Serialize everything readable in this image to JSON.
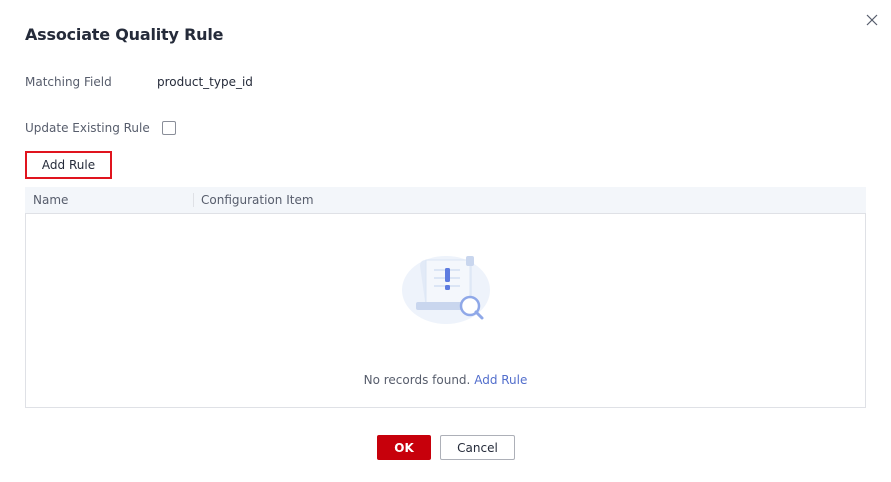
{
  "dialog": {
    "title": "Associate Quality Rule"
  },
  "form": {
    "matching_field_label": "Matching Field",
    "matching_field_value": "product_type_id",
    "update_existing_label": "Update Existing Rule",
    "update_existing_checked": false
  },
  "toolbar": {
    "add_rule_label": "Add Rule"
  },
  "table": {
    "columns": [
      "Name",
      "Configuration Item"
    ],
    "rows": [],
    "empty_text": "No records found.",
    "empty_link": "Add Rule"
  },
  "footer": {
    "ok_label": "OK",
    "cancel_label": "Cancel"
  },
  "colors": {
    "primary": "#c7000b",
    "highlight_border": "#e0141e",
    "link": "#526ecc",
    "header_bg": "#f3f6fa"
  },
  "icons": {
    "close": "close-icon",
    "empty": "empty-records-icon"
  }
}
